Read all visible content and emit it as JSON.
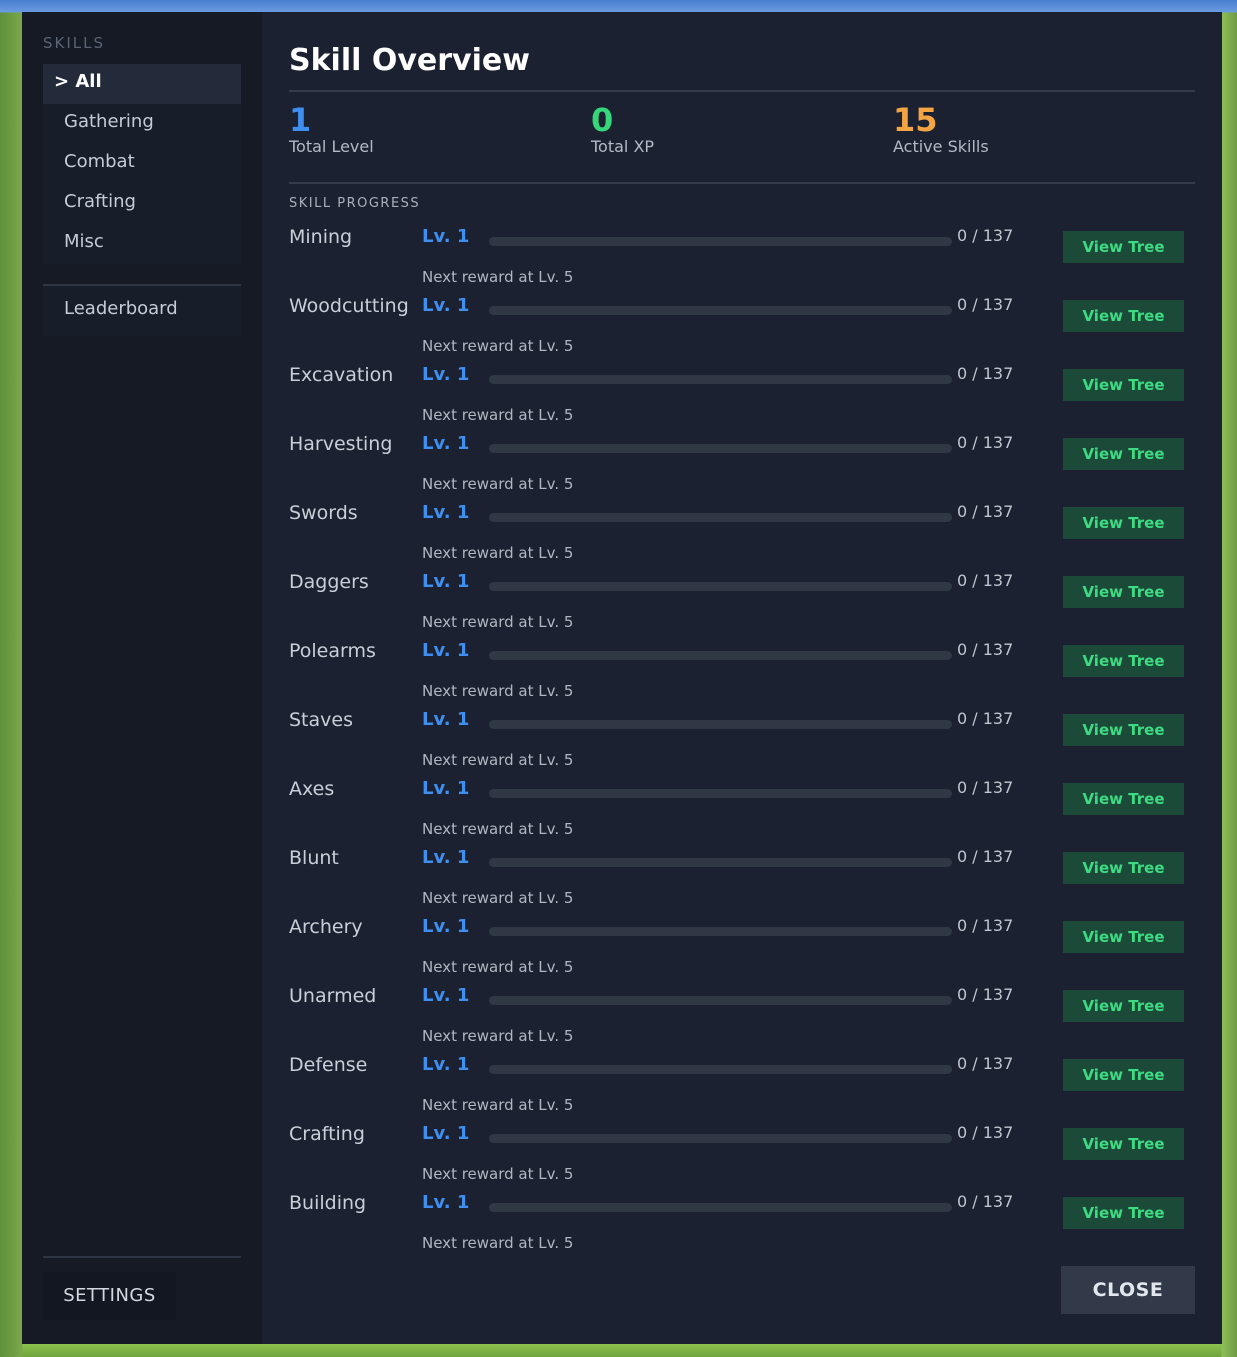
{
  "sidebar": {
    "title": "SKILLS",
    "items": [
      {
        "label": "> All",
        "active": true
      },
      {
        "label": "Gathering",
        "active": false
      },
      {
        "label": "Combat",
        "active": false
      },
      {
        "label": "Crafting",
        "active": false
      },
      {
        "label": "Misc",
        "active": false
      }
    ],
    "leaderboard_label": "Leaderboard",
    "settings_label": "SETTINGS"
  },
  "main": {
    "title": "Skill Overview",
    "stats": [
      {
        "value": "1",
        "label": "Total Level",
        "color": "#3e8ff0"
      },
      {
        "value": "0",
        "label": "Total XP",
        "color": "#35d77a"
      },
      {
        "value": "15",
        "label": "Active Skills",
        "color": "#f5a443"
      }
    ],
    "section_label": "SKILL PROGRESS",
    "skills": [
      {
        "name": "Mining",
        "level": "Lv. 1",
        "xp": "0 / 137",
        "progress": 0,
        "next_reward": "Next reward at Lv. 5",
        "button": "View Tree"
      },
      {
        "name": "Woodcutting",
        "level": "Lv. 1",
        "xp": "0 / 137",
        "progress": 0,
        "next_reward": "Next reward at Lv. 5",
        "button": "View Tree"
      },
      {
        "name": "Excavation",
        "level": "Lv. 1",
        "xp": "0 / 137",
        "progress": 0,
        "next_reward": "Next reward at Lv. 5",
        "button": "View Tree"
      },
      {
        "name": "Harvesting",
        "level": "Lv. 1",
        "xp": "0 / 137",
        "progress": 0,
        "next_reward": "Next reward at Lv. 5",
        "button": "View Tree"
      },
      {
        "name": "Swords",
        "level": "Lv. 1",
        "xp": "0 / 137",
        "progress": 0,
        "next_reward": "Next reward at Lv. 5",
        "button": "View Tree"
      },
      {
        "name": "Daggers",
        "level": "Lv. 1",
        "xp": "0 / 137",
        "progress": 0,
        "next_reward": "Next reward at Lv. 5",
        "button": "View Tree"
      },
      {
        "name": "Polearms",
        "level": "Lv. 1",
        "xp": "0 / 137",
        "progress": 0,
        "next_reward": "Next reward at Lv. 5",
        "button": "View Tree"
      },
      {
        "name": "Staves",
        "level": "Lv. 1",
        "xp": "0 / 137",
        "progress": 0,
        "next_reward": "Next reward at Lv. 5",
        "button": "View Tree"
      },
      {
        "name": "Axes",
        "level": "Lv. 1",
        "xp": "0 / 137",
        "progress": 0,
        "next_reward": "Next reward at Lv. 5",
        "button": "View Tree"
      },
      {
        "name": "Blunt",
        "level": "Lv. 1",
        "xp": "0 / 137",
        "progress": 0,
        "next_reward": "Next reward at Lv. 5",
        "button": "View Tree"
      },
      {
        "name": "Archery",
        "level": "Lv. 1",
        "xp": "0 / 137",
        "progress": 0,
        "next_reward": "Next reward at Lv. 5",
        "button": "View Tree"
      },
      {
        "name": "Unarmed",
        "level": "Lv. 1",
        "xp": "0 / 137",
        "progress": 0,
        "next_reward": "Next reward at Lv. 5",
        "button": "View Tree"
      },
      {
        "name": "Defense",
        "level": "Lv. 1",
        "xp": "0 / 137",
        "progress": 0,
        "next_reward": "Next reward at Lv. 5",
        "button": "View Tree"
      },
      {
        "name": "Crafting",
        "level": "Lv. 1",
        "xp": "0 / 137",
        "progress": 0,
        "next_reward": "Next reward at Lv. 5",
        "button": "View Tree"
      },
      {
        "name": "Building",
        "level": "Lv. 1",
        "xp": "0 / 137",
        "progress": 0,
        "next_reward": "Next reward at Lv. 5",
        "button": "View Tree"
      }
    ],
    "close_label": "CLOSE"
  }
}
